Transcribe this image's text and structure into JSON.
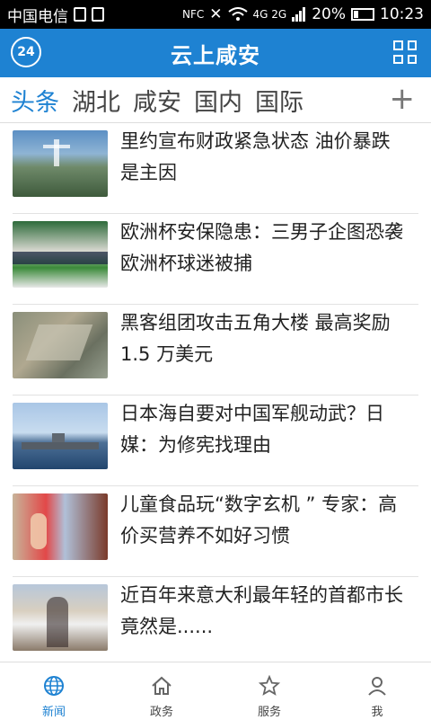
{
  "status_bar": {
    "carrier": "中国电信",
    "nfc": "NFC",
    "network": "4G 2G",
    "battery": "20%",
    "time": "10:23"
  },
  "header": {
    "logo_text": "24",
    "title": "云上咸安"
  },
  "tabs": [
    {
      "label": "头条",
      "active": true
    },
    {
      "label": "湖北",
      "active": false
    },
    {
      "label": "咸安",
      "active": false
    },
    {
      "label": "国内",
      "active": false
    },
    {
      "label": "国际",
      "active": false
    }
  ],
  "tab_add_label": "+",
  "news": [
    {
      "title": "里约宣布财政紧急状态 油价暴跌是主因"
    },
    {
      "title": "欧洲杯安保隐患：三男子企图恐袭欧洲杯球迷被捕"
    },
    {
      "title": "黑客组团攻击五角大楼 最高奖励 1.5 万美元"
    },
    {
      "title": "日本海自要对中国军舰动武？日媒：为修宪找理由"
    },
    {
      "title": "儿童食品玩“数字玄机 ” 专家：高价买营养不如好习惯"
    },
    {
      "title": "近百年来意大利最年轻的首都市长竟然是......"
    }
  ],
  "bottom_nav": [
    {
      "label": "新闻",
      "icon": "globe-icon",
      "active": true
    },
    {
      "label": "政务",
      "icon": "home-icon",
      "active": false
    },
    {
      "label": "服务",
      "icon": "star-icon",
      "active": false
    },
    {
      "label": "我",
      "icon": "user-icon",
      "active": false
    }
  ],
  "colors": {
    "accent": "#1e82d2",
    "status_bar": "#000000"
  }
}
